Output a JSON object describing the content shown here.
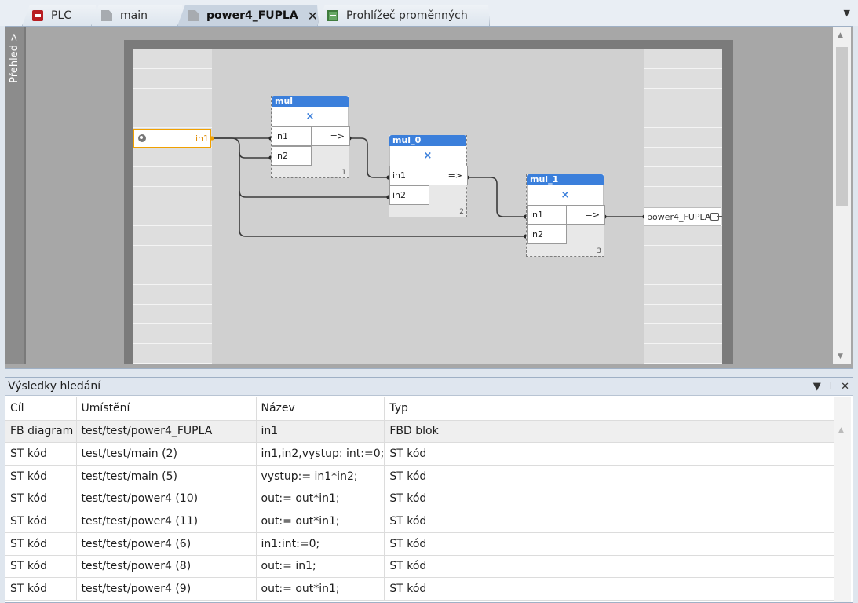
{
  "tabs": [
    {
      "label": "PLC",
      "icon": "plc-icon"
    },
    {
      "label": "main",
      "icon": "document-icon"
    },
    {
      "label": "power4_FUPLA",
      "icon": "document-icon",
      "active": true,
      "close": "✕"
    },
    {
      "label": "Prohlížeč proměnných",
      "icon": "variable-browser-icon"
    }
  ],
  "editor": {
    "overview_label": "Přehled >",
    "input_var": "in1",
    "output_var": "power4_FUPLA",
    "blocks": [
      {
        "name": "mul",
        "symbol": "×",
        "in1": "in1",
        "in2": "in2",
        "out": "=>",
        "num": "1"
      },
      {
        "name": "mul_0",
        "symbol": "×",
        "in1": "in1",
        "in2": "in2",
        "out": "=>",
        "num": "2"
      },
      {
        "name": "mul_1",
        "symbol": "×",
        "in1": "in1",
        "in2": "in2",
        "out": "=>",
        "num": "3"
      }
    ]
  },
  "search_panel": {
    "title": "Výsledky hledání",
    "columns": [
      "Cíl",
      "Umístění",
      "Název",
      "Typ"
    ],
    "rows": [
      [
        "FB diagram",
        "test/test/power4_FUPLA",
        "in1",
        "FBD blok"
      ],
      [
        "ST kód",
        "test/test/main (2)",
        "in1,in2,vystup: int:=0;",
        "ST kód"
      ],
      [
        "ST kód",
        "test/test/main (5)",
        "vystup:= in1*in2;",
        "ST kód"
      ],
      [
        "ST kód",
        "test/test/power4 (10)",
        "out:= out*in1;",
        "ST kód"
      ],
      [
        "ST kód",
        "test/test/power4 (11)",
        "out:= out*in1;",
        "ST kód"
      ],
      [
        "ST kód",
        "test/test/power4 (6)",
        "in1:int:=0;",
        "ST kód"
      ],
      [
        "ST kód",
        "test/test/power4 (8)",
        "out:= in1;",
        "ST kód"
      ],
      [
        "ST kód",
        "test/test/power4 (9)",
        "out:= out*in1;",
        "ST kód"
      ]
    ]
  },
  "colors": {
    "block_header": "#3b7fdb",
    "input_highlight": "#f0a000"
  }
}
